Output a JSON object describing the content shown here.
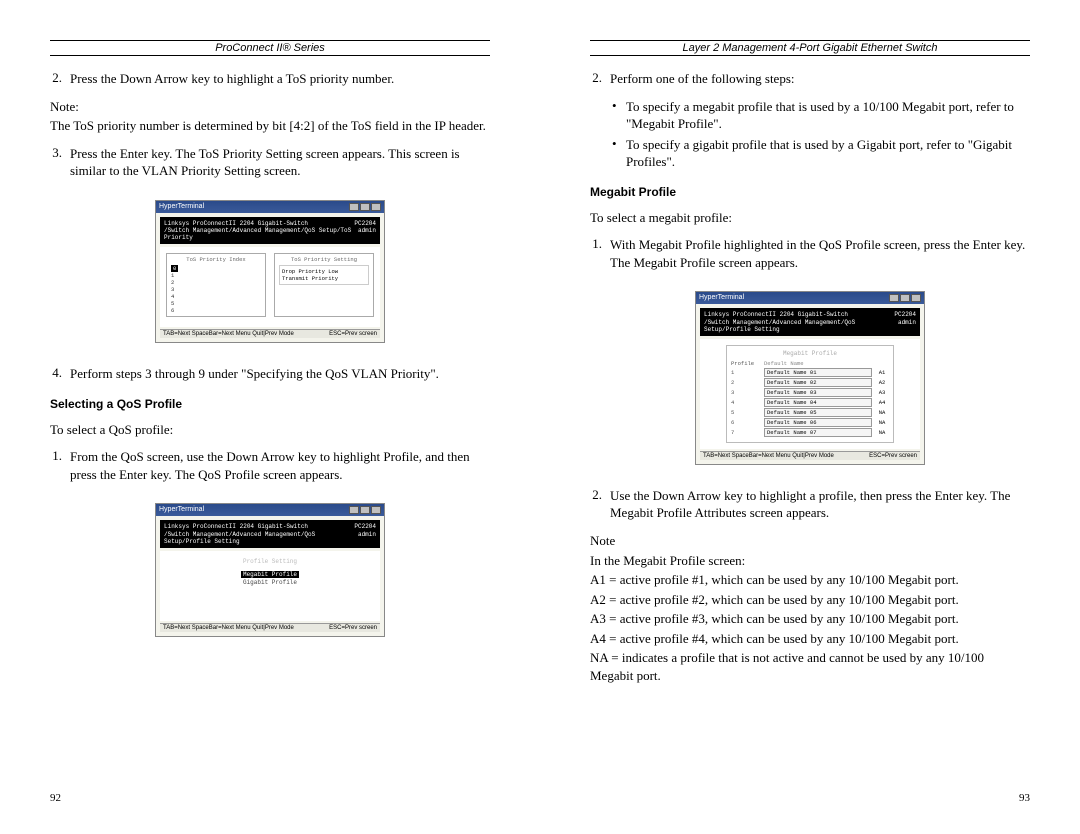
{
  "left": {
    "header": "ProConnect II® Series",
    "item2_num": "2.",
    "item2": "Press the Down Arrow key to highlight a ToS priority number.",
    "note_label": "Note:",
    "note_text": "The ToS priority number is determined by bit [4:2] of the ToS field in the IP header.",
    "item3_num": "3.",
    "item3": "Press the Enter key. The ToS Priority Setting screen appears. This screen is similar to the VLAN Priority Setting screen.",
    "item4_num": "4.",
    "item4": "Perform steps 3 through 9 under \"Specifying the QoS VLAN Priority\".",
    "heading": "Selecting a QoS Profile",
    "intro": "To select a QoS profile:",
    "qos1_num": "1.",
    "qos1": "From the QoS screen, use the Down Arrow key to highlight Profile, and then press the Enter key. The QoS Profile screen appears.",
    "page_num": "92",
    "ss1": {
      "title": "HyperTerminal",
      "black_left": "Linksys ProConnectII 2204 Gigabit-Switch",
      "black_right": "PC2204",
      "black_sub": "/Switch Management/Advanced Management/QoS Setup/ToS Priority",
      "admin": "admin",
      "col1_title": "ToS Priority Index",
      "col2_title": "ToS Priority Setting",
      "top_line": "Drop Priority     Low",
      "sub_line": "Transmit Priority",
      "rows": [
        "0",
        "1",
        "2",
        "3",
        "4",
        "5",
        "6"
      ],
      "status_left": "TAB=Next  SpaceBar=Next Menu   Quit|Prev Mode",
      "status_right": "ESC=Prev screen"
    },
    "ss2": {
      "title": "HyperTerminal",
      "black_left": "Linksys ProConnectII 2204 Gigabit-Switch",
      "black_right": "PC2204",
      "black_sub": "/Switch Management/Advanced Management/QoS Setup/Profile Setting",
      "admin": "admin",
      "row1": "Profile Setting",
      "row2a": "Megabit Profile",
      "row2b": "Gigabit Profile",
      "status_left": "TAB=Next  SpaceBar=Next Menu   Quit|Prev Mode",
      "status_right": "ESC=Prev screen"
    }
  },
  "right": {
    "header": "Layer 2 Management 4-Port Gigabit Ethernet Switch",
    "item2_num": "2.",
    "item2": "Perform one of the following steps:",
    "bullet1": "To specify a megabit profile that is used by a 10/100 Megabit port, refer to \"Megabit Profile\".",
    "bullet2": "To specify a gigabit profile that is used by a Gigabit port, refer to  \"Gigabit Profiles\".",
    "heading": "Megabit Profile",
    "intro": "To select a megabit profile:",
    "mb1_num": "1.",
    "mb1": "With Megabit Profile highlighted in the QoS Profile screen, press the Enter key. The Megabit Profile screen appears.",
    "mb2_num": "2.",
    "mb2": "Use the Down Arrow key to highlight a profile, then press the Enter key. The Megabit Profile Attributes screen appears.",
    "note_label": "Note",
    "note_text_intro": "In the Megabit Profile screen:",
    "a1": "A1 = active profile #1, which can be used by any 10/100 Megabit port.",
    "a2": "A2 = active profile #2, which can be used by any 10/100 Megabit port.",
    "a3": "A3 = active profile #3, which can be used by any 10/100 Megabit port.",
    "a4": "A4 = active profile #4, which can be used by any 10/100 Megabit port.",
    "na": "NA = indicates a profile that is not active and cannot be used by any 10/100 Megabit port.",
    "page_num": "93",
    "ss": {
      "title": "HyperTerminal",
      "black_left": "Linksys ProConnectII 2204 Gigabit-Switch",
      "black_right": "PC2204",
      "black_sub": "/Switch Management/Advanced Management/QoS Setup/Profile Setting",
      "admin": "admin",
      "box_title": "Megabit Profile",
      "col_profile": "Profile",
      "col_name": "Default Name",
      "rows": [
        {
          "p": "1",
          "n": "Default Name 01",
          "s": "A1"
        },
        {
          "p": "2",
          "n": "Default Name 02",
          "s": "A2"
        },
        {
          "p": "3",
          "n": "Default Name 03",
          "s": "A3"
        },
        {
          "p": "4",
          "n": "Default Name 04",
          "s": "A4"
        },
        {
          "p": "5",
          "n": "Default Name 05",
          "s": "NA"
        },
        {
          "p": "6",
          "n": "Default Name 06",
          "s": "NA"
        },
        {
          "p": "7",
          "n": "Default Name 07",
          "s": "NA"
        }
      ],
      "status_left": "TAB=Next  SpaceBar=Next Menu   Quit|Prev Mode",
      "status_right": "ESC=Prev screen"
    }
  }
}
